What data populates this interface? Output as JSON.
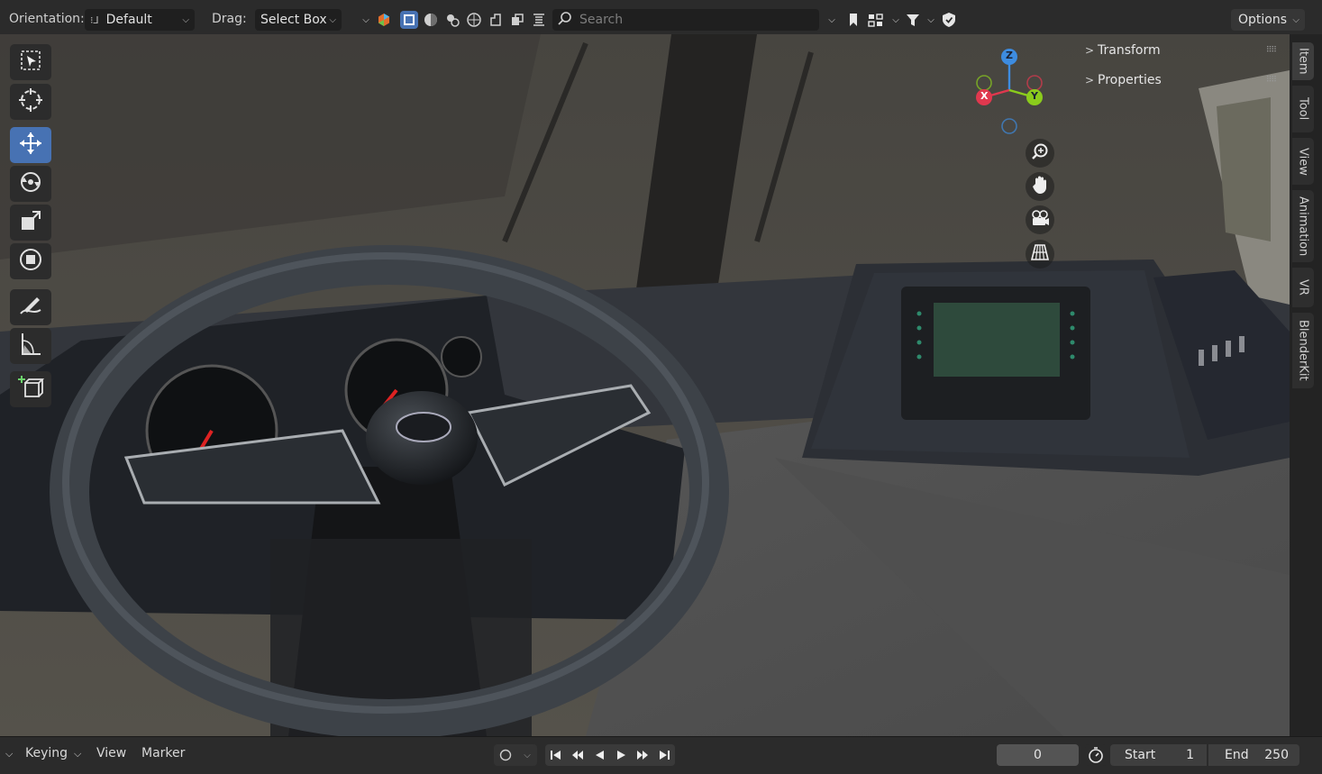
{
  "header": {
    "orientation_label": "Orientation:",
    "orientation_value": "Default",
    "drag_label": "Drag:",
    "drag_value": "Select Box",
    "search_placeholder": "Search",
    "options_label": "Options",
    "select_mode_icons": [
      "select-new-icon",
      "select-extend-icon",
      "select-subtract-icon",
      "select-invert-icon",
      "select-intersect-icon"
    ],
    "accent_color": "#4772b3"
  },
  "toolbar": {
    "tools": [
      "select-box",
      "cursor",
      "move",
      "rotate",
      "scale",
      "transform",
      "annotate",
      "measure",
      "add-cube"
    ],
    "active_tool": "move"
  },
  "gizmo": {
    "x_label": "X",
    "y_label": "Y",
    "z_label": "Z",
    "x_color": "#e0384e",
    "y_color": "#8bcc1c",
    "z_color": "#3d8ce0"
  },
  "sidebar": {
    "sections": [
      {
        "label": "Transform"
      },
      {
        "label": "Properties"
      }
    ],
    "tabs": [
      "Item",
      "Tool",
      "View",
      "Animation",
      "VR",
      "BlenderKit"
    ],
    "active_tab": "Item"
  },
  "timeline": {
    "menu_keying": "Keying",
    "menu_view": "View",
    "menu_marker": "Marker",
    "current_frame": "0",
    "start_label": "Start",
    "start_value": "1",
    "end_label": "End",
    "end_value": "250"
  }
}
